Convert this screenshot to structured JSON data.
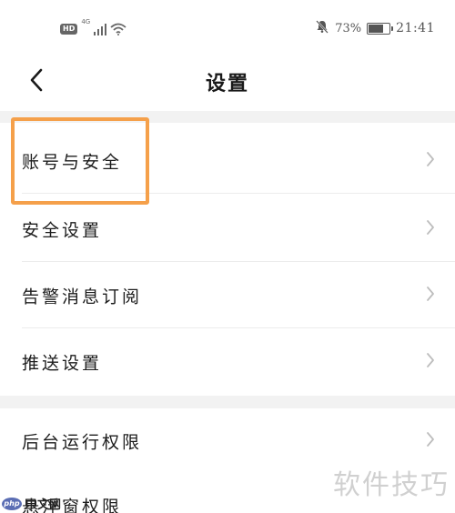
{
  "status_bar": {
    "hd_label": "HD",
    "network_label": "4G",
    "signal_bars": 4,
    "battery_percent_text": "73%",
    "battery_level": 0.73,
    "time": "21:41",
    "icons": [
      "hd-icon",
      "signal-icon",
      "wifi-icon",
      "mute-bell-icon",
      "battery-icon"
    ]
  },
  "header": {
    "title": "设置",
    "back_icon": "chevron-left-icon"
  },
  "settings": {
    "items": [
      {
        "label": "账号与安全"
      },
      {
        "label": "安全设置"
      },
      {
        "label": "告警消息订阅"
      },
      {
        "label": "推送设置"
      },
      {
        "label": "后台运行权限"
      },
      {
        "label": "悬浮窗权限"
      }
    ]
  },
  "annotation": {
    "highlight_color": "#f5a04a"
  },
  "watermarks": {
    "right": "软件技巧",
    "left_logo": "php",
    "left_text": "中文网"
  }
}
